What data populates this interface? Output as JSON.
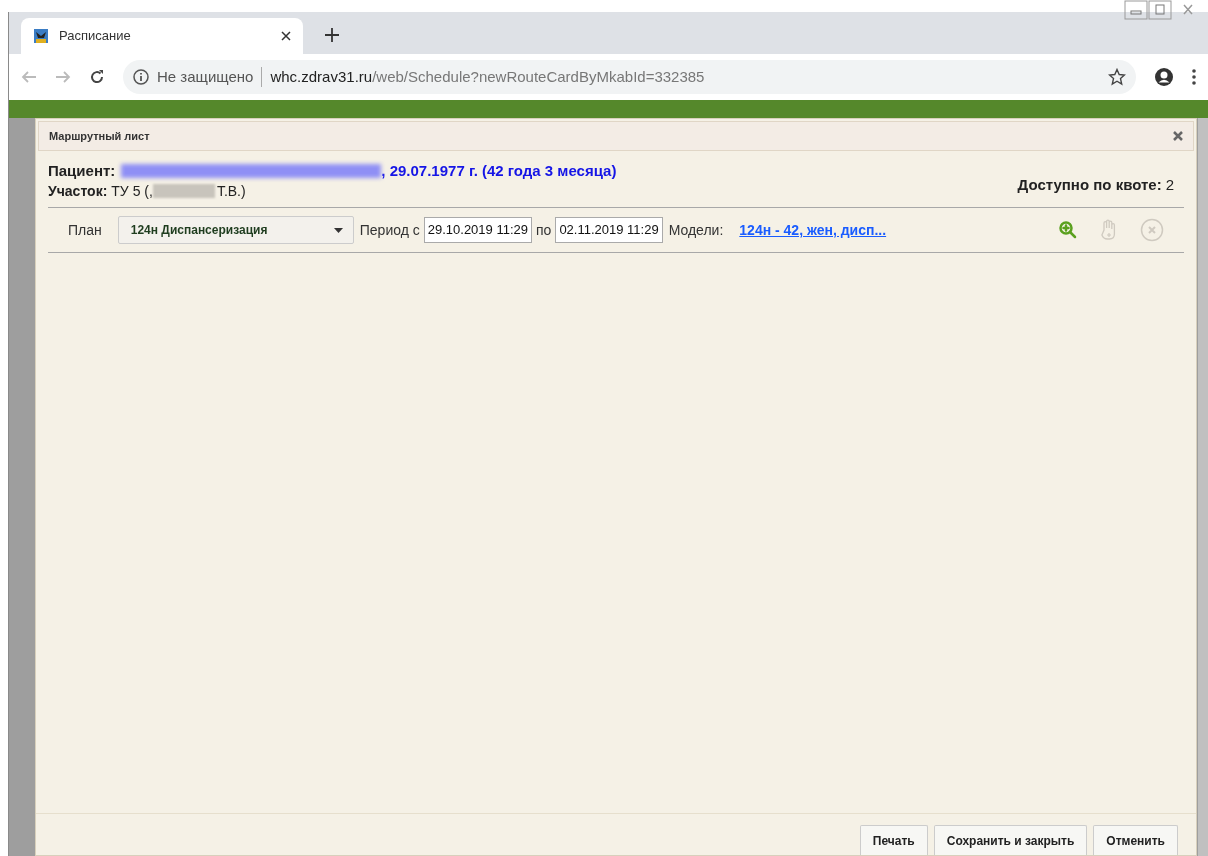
{
  "browser": {
    "tab_title": "Расписание",
    "security": "Не защищено",
    "url_host": "whc.zdrav31.ru",
    "url_path": "/web/Schedule?newRouteCardByMkabId=332385"
  },
  "dialog": {
    "title": "Маршрутный лист",
    "patient_label": "Пациент:",
    "patient_info": ", 29.07.1977 г. (42 года 3 месяца)",
    "district_label": "Участок:",
    "district_prefix": "ТУ 5 (,",
    "district_suffix": "Т.В.)",
    "quota_label": "Доступно по квоте:",
    "quota_value": "2",
    "plan_label": "План",
    "plan_value": "124н Диспансеризация",
    "period_label": "Период с",
    "period_from": "29.10.2019 11:29",
    "period_to_label": "по",
    "period_to": "02.11.2019 11:29",
    "models_label": "Модели:",
    "models_link": "124н - 42, жен, дисп...",
    "tools": [
      {
        "kind": "zoom",
        "disabled": false
      },
      {
        "kind": "hand",
        "disabled": true
      },
      {
        "kind": "remove",
        "disabled": true
      }
    ],
    "buttons": [
      "Печать",
      "Сохранить и закрыть",
      "Отменить"
    ]
  }
}
